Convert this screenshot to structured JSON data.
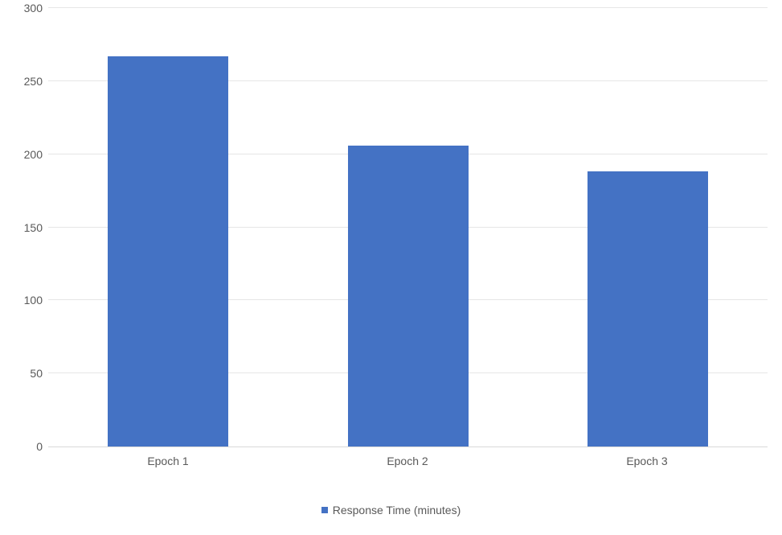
{
  "chart_data": {
    "type": "bar",
    "categories": [
      "Epoch 1",
      "Epoch 2",
      "Epoch 3"
    ],
    "values": [
      267,
      206,
      188
    ],
    "title": "",
    "xlabel": "",
    "ylabel": "",
    "ylim": [
      0,
      300
    ],
    "ytick_step": 50,
    "series_name": "Response Time (minutes)",
    "series_color": "#4472c4",
    "grid": true
  },
  "yticks": [
    {
      "label": "0"
    },
    {
      "label": "50"
    },
    {
      "label": "100"
    },
    {
      "label": "150"
    },
    {
      "label": "200"
    },
    {
      "label": "250"
    },
    {
      "label": "300"
    }
  ],
  "legend": {
    "label": "Response Time (minutes)"
  }
}
